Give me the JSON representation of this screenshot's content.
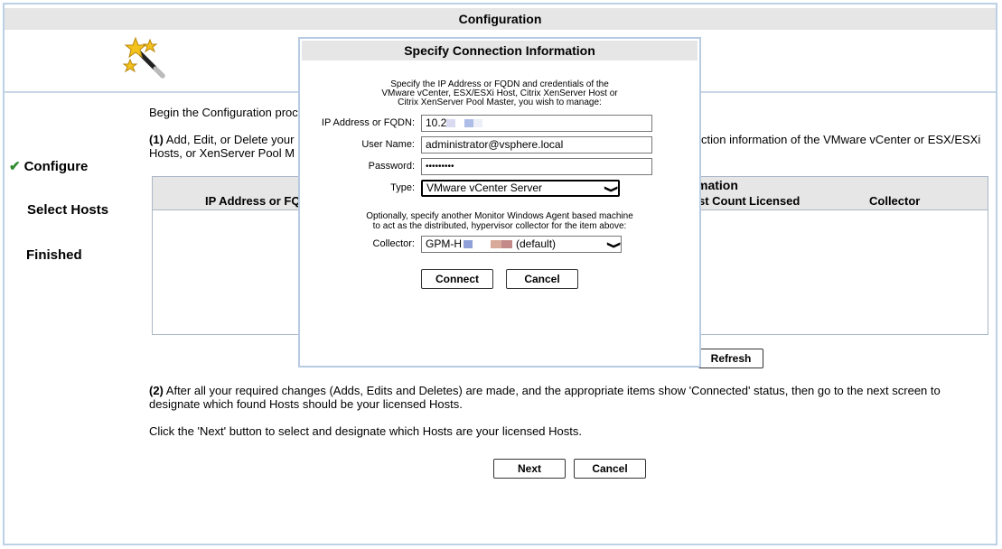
{
  "window": {
    "title": "Configuration"
  },
  "steps": [
    {
      "label": "Configure",
      "active": true
    },
    {
      "label": "Select Hosts",
      "active": false
    },
    {
      "label": "Finished",
      "active": false
    }
  ],
  "main": {
    "intro": "Begin the Configuration proc",
    "step1_num": "(1)",
    "step1_text_left": " Add, Edit, or Delete your",
    "step1_text_right": "ction information of the VMware vCenter or ESX/ESXi",
    "step1_line2": "Hosts, or XenServer Pool M",
    "step2_num": "(2)",
    "step2_line1": " After all your required changes (Adds, Edits and Deletes) are made, and the appropriate items show 'Connected' status, then go to the next screen to",
    "step2_line2": "designate which found Hosts should be your licensed Hosts.",
    "next_hint": "Click the 'Next' button to select and designate which Hosts are your licensed Hosts."
  },
  "hosts_table": {
    "header_title_fragment": "mation",
    "columns": [
      "IP Address or FQD",
      "st Count",
      "Licensed",
      "Collector"
    ],
    "rows": []
  },
  "buttons": {
    "refresh": "Refresh",
    "next": "Next",
    "cancel": "Cancel"
  },
  "dialog": {
    "title": "Specify Connection Information",
    "desc_lines": [
      "Specify the IP Address or FQDN and credentials of the",
      "VMware vCenter, ESX/ESXi Host, Citrix XenServer Host or",
      "Citrix XenServer Pool Master, you wish to manage:"
    ],
    "ip_label": "IP Address or FQDN:",
    "ip_value": "10.2",
    "user_label": "User Name:",
    "user_value": "administrator@vsphere.local",
    "password_label": "Password:",
    "password_value": "•••••••••",
    "type_label": "Type:",
    "type_value": "VMware vCenter Server",
    "optional_lines": [
      "Optionally, specify another Monitor Windows Agent based machine",
      "to act as the distributed, hypervisor collector for the item above:"
    ],
    "collector_label": "Collector:",
    "collector_value_prefix": "GPM-H",
    "collector_value_suffix": "(default)",
    "connect": "Connect",
    "cancel": "Cancel"
  },
  "icons": {
    "wand": "magic-wand-icon",
    "check": "checkmark-icon",
    "chevron": "chevron-down-icon"
  },
  "colors": {
    "check": "#2e8b2e",
    "header_bg": "#e6e6e6",
    "border": "#b7cbe3"
  }
}
